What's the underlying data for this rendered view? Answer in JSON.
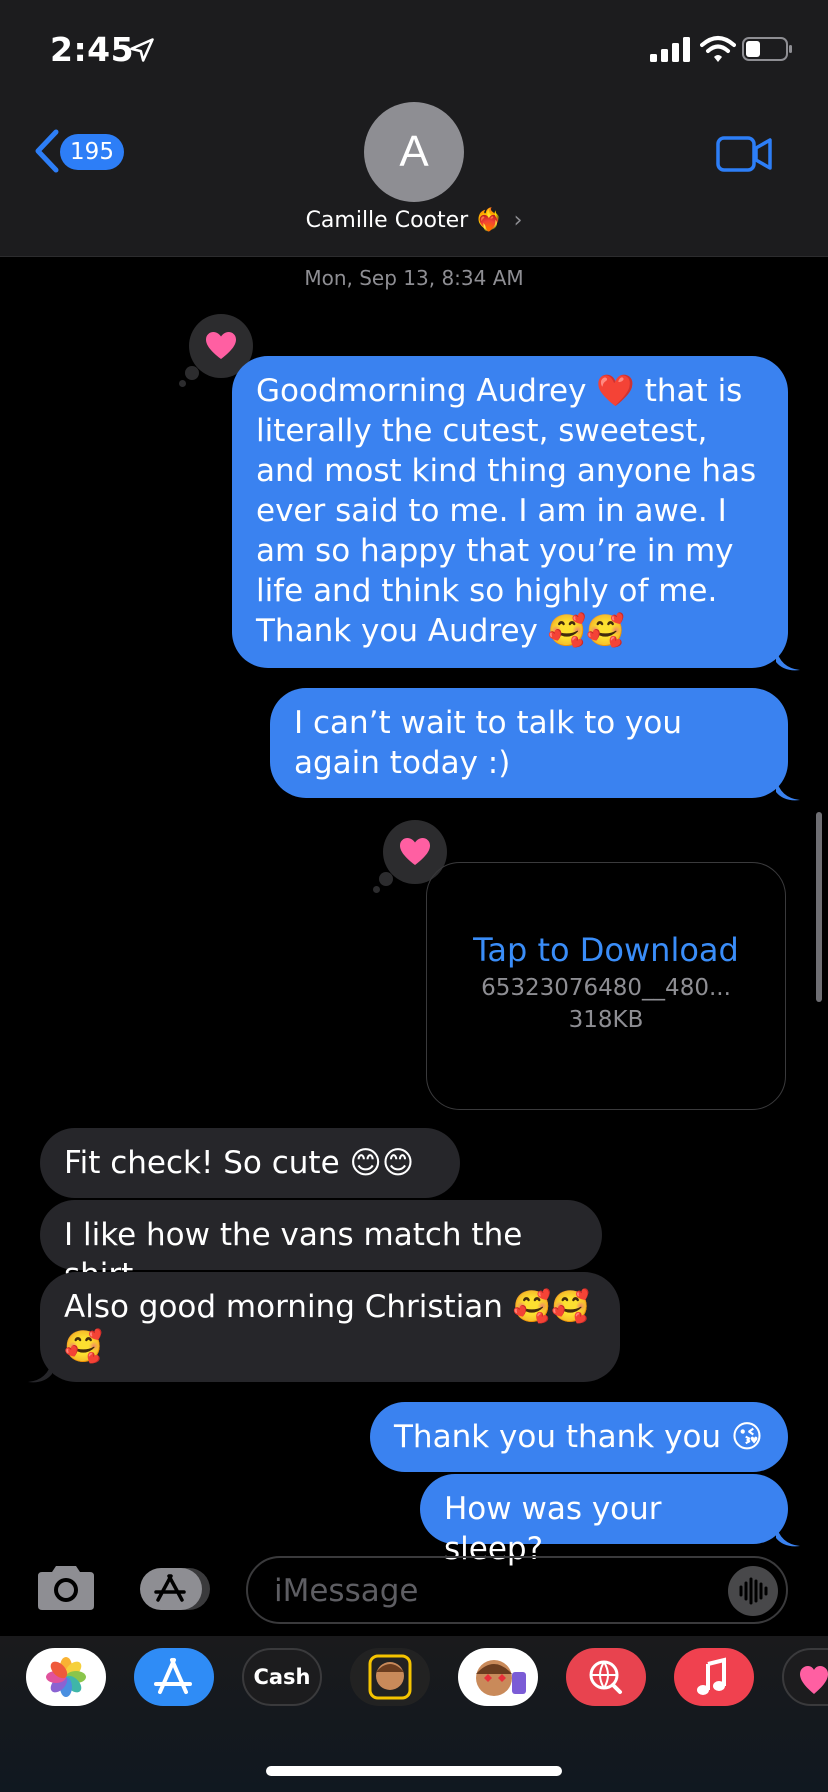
{
  "status_bar": {
    "time": "2:45"
  },
  "header": {
    "back_count": "195",
    "avatar_initial": "A",
    "contact_name": "Camille Cooter",
    "contact_emoji": "❤️‍🔥",
    "chevron": "›"
  },
  "timestamp": {
    "day": "Mon, Sep 13,",
    "time": "8:34 AM"
  },
  "messages": [
    {
      "side": "outgoing",
      "text": "Goodmorning Audrey ❤️ that is literally the cutest, sweetest, and most kind thing anyone has ever said to me. I am in awe. I am so happy that you’re in my life and think so highly of me. Thank you Audrey 🥰🥰",
      "tapback": "heart"
    },
    {
      "side": "outgoing",
      "text": "I can’t wait to talk to you again today :)"
    },
    {
      "side": "outgoing",
      "type": "attachment",
      "title": "Tap to Download",
      "filename": "65323076480__480...",
      "size": "318KB",
      "tapback": "heart"
    },
    {
      "side": "incoming",
      "text": "Fit check! So cute 😊😊"
    },
    {
      "side": "incoming",
      "text": "I like how the vans match the shirt"
    },
    {
      "side": "incoming",
      "text": "Also good morning Christian 🥰🥰🥰"
    },
    {
      "side": "outgoing",
      "text": "Thank you thank you 😘"
    },
    {
      "side": "outgoing",
      "text": "How was your sleep?"
    }
  ],
  "input": {
    "placeholder": "iMessage"
  },
  "drawer": {
    "apps": [
      {
        "name": "Photos"
      },
      {
        "name": "App Store"
      },
      {
        "name": "Cash",
        "label": "Cash"
      },
      {
        "name": "Memoji"
      },
      {
        "name": "Memoji Stickers"
      },
      {
        "name": "Images"
      },
      {
        "name": "Music"
      },
      {
        "name": "Digital Touch"
      }
    ]
  },
  "colors": {
    "outgoing_bubble": "#3a82f0",
    "incoming_bubble": "#26262a",
    "accent": "#2d7ef7",
    "tapback_heart": "#ff5fa2"
  }
}
